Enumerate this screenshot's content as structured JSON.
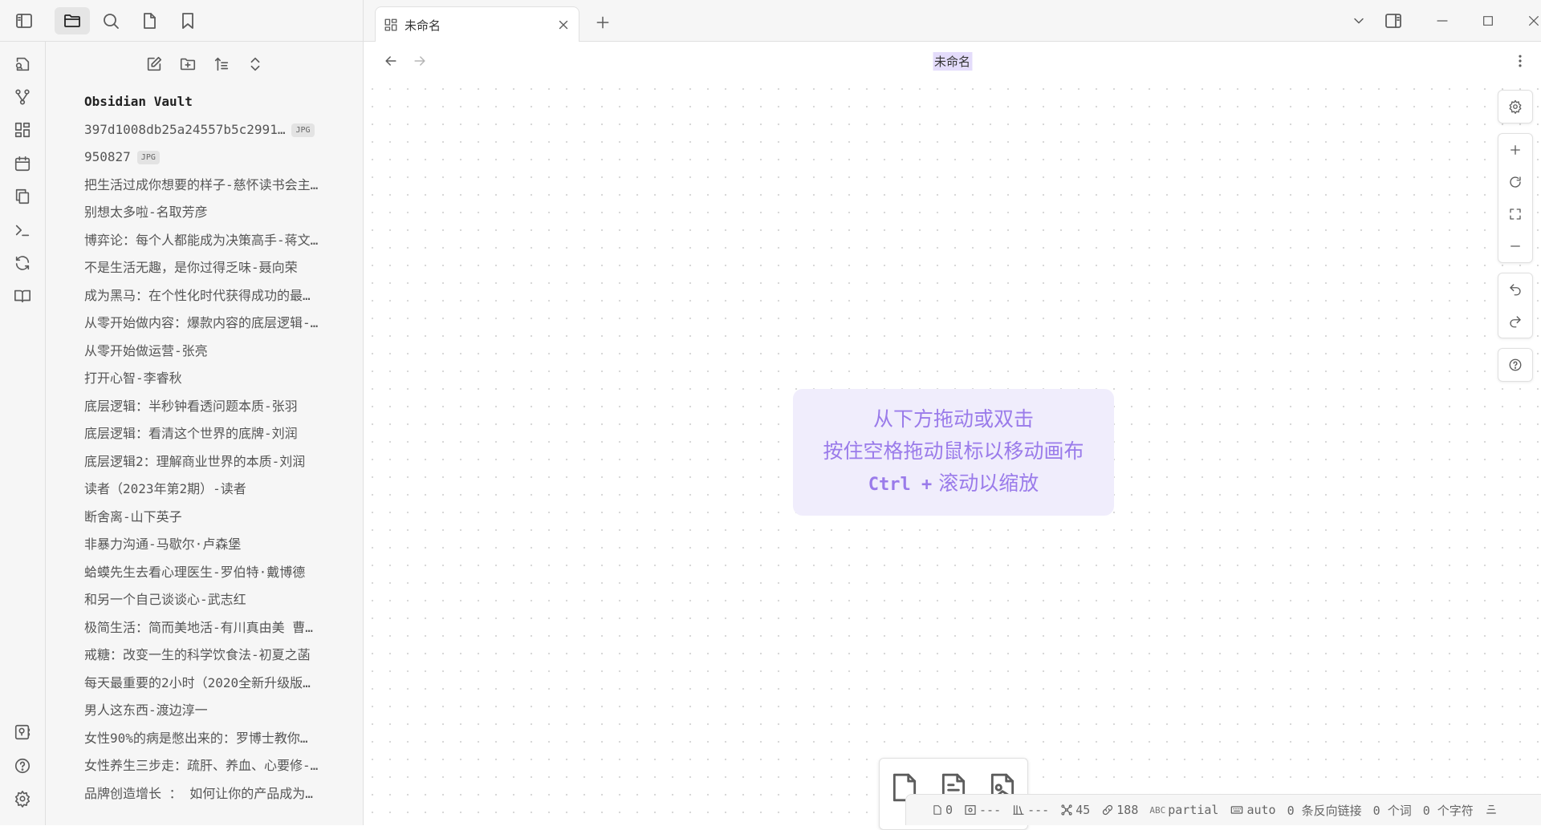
{
  "tab": {
    "title": "未命名"
  },
  "nav": {
    "doc_title": "未命名"
  },
  "sidebar": {
    "vault_name": "Obsidian Vault",
    "files": [
      {
        "name": "397d1008db25a24557b5c2991…",
        "badge": "JPG"
      },
      {
        "name": "950827",
        "badge": "JPG"
      },
      {
        "name": "把生活过成你想要的样子-慈怀读书会主…"
      },
      {
        "name": "别想太多啦-名取芳彦"
      },
      {
        "name": "博弈论：每个人都能成为决策高手-蒋文…"
      },
      {
        "name": "不是生活无趣，是你过得乏味-聂向荣"
      },
      {
        "name": "成为黑马：在个性化时代获得成功的最…"
      },
      {
        "name": "从零开始做内容：爆款内容的底层逻辑-…"
      },
      {
        "name": "从零开始做运营-张亮"
      },
      {
        "name": "打开心智-李睿秋"
      },
      {
        "name": "底层逻辑：半秒钟看透问题本质-张羽"
      },
      {
        "name": "底层逻辑：看清这个世界的底牌-刘润"
      },
      {
        "name": "底层逻辑2：理解商业世界的本质-刘润"
      },
      {
        "name": "读者（2023年第2期）-读者"
      },
      {
        "name": "断舍离-山下英子"
      },
      {
        "name": "非暴力沟通-马歇尔·卢森堡"
      },
      {
        "name": "蛤蟆先生去看心理医生-罗伯特·戴博德"
      },
      {
        "name": "和另一个自己谈谈心-武志红"
      },
      {
        "name": "极简生活：简而美地活-有川真由美 曹…"
      },
      {
        "name": "戒糖：改变一生的科学饮食法-初夏之菡"
      },
      {
        "name": "每天最重要的2小时（2020全新升级版…"
      },
      {
        "name": "男人这东西-渡边淳一"
      },
      {
        "name": "女性90%的病是憋出来的：罗博士教你…"
      },
      {
        "name": "女性养生三步走：疏肝、养血、心要修-…"
      },
      {
        "name": "品牌创造增长 ： 如何让你的产品成为…"
      }
    ]
  },
  "hint": {
    "line1": "从下方拖动或双击",
    "line2": "按住空格拖动鼠标以移动画布",
    "line3_key": "Ctrl +",
    "line3_text": "滚动以缩放"
  },
  "status": {
    "edit_count": "0",
    "stat2": "---",
    "stat3": "---",
    "nodes": "45",
    "links": "188",
    "spell_label": "ABC",
    "spell": "partial",
    "input_mode": "auto",
    "backlinks": "0 条反向链接",
    "words": "0 个词",
    "chars": "0 个字符"
  }
}
